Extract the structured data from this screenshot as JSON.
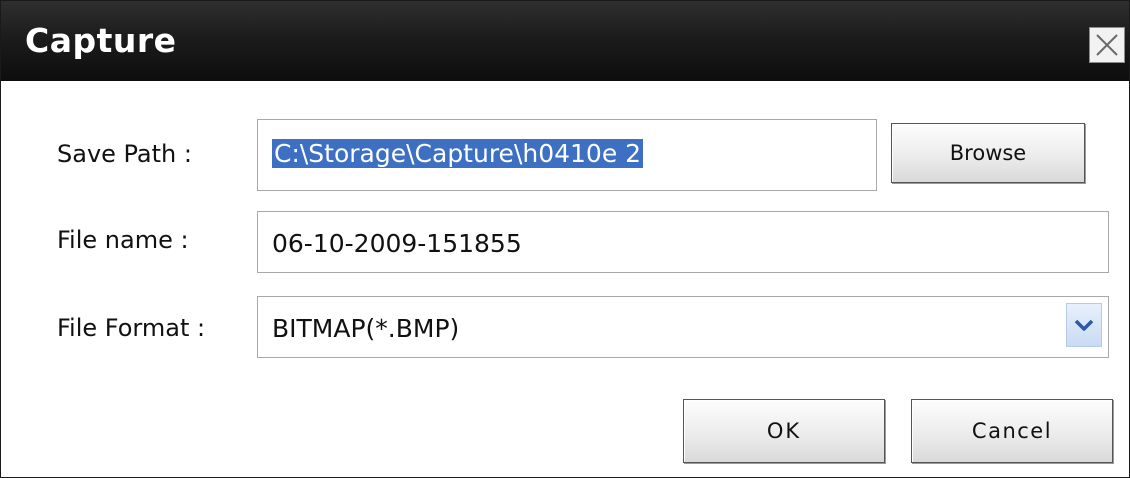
{
  "dialog": {
    "title": "Capture",
    "close_icon": "close-icon"
  },
  "form": {
    "save_path_label": "Save Path :",
    "save_path_value": "C:\\Storage\\Capture\\h0410e 2",
    "browse_label": "Browse",
    "file_name_label": "File name :",
    "file_name_value": "06-10-2009-151855",
    "file_format_label": "File Format :",
    "file_format_value": "BITMAP(*.BMP)",
    "dropdown_icon": "chevron-down-icon"
  },
  "buttons": {
    "ok_label": "OK",
    "cancel_label": "Cancel"
  },
  "colors": {
    "titlebar": "#1c1c1c",
    "selection": "#3d6fc2",
    "dropdown_arrow": "#c9dbf3"
  }
}
